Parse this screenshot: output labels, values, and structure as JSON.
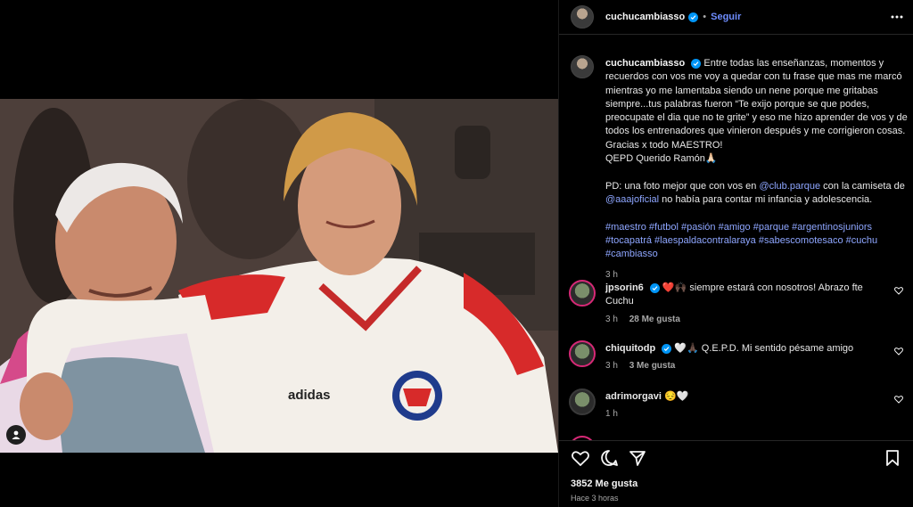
{
  "post": {
    "username": "cuchucambiasso",
    "follow_label": "Seguir",
    "dot": "•",
    "caption_pre": "Entre todas las enseñanzas, momentos y recuerdos con vos me voy a quedar con tu frase que mas me marcó mientras yo me lamentaba siendo un nene porque me gritabas siempre...tus palabras fueron “Te exijo porque se que podes, preocupate el dia que no te grite” y eso me hizo aprender de vos y de todos los entrenadores que vinieron después y me corrigieron cosas. Gracias x todo MAESTRO!",
    "caption_line2": "QEPD Querido Ramón🙏🏻",
    "caption_ps_1": "PD: una foto mejor que con vos en ",
    "mention_1": "@club.parque",
    "caption_ps_2": " con la camiseta de ",
    "mention_2": "@aaajoficial",
    "caption_ps_3": " no había para contar mi infancia y adolescencia.",
    "hashtags": "#maestro #futbol #pasión #amigo #parque #argentinosjuniors #tocapatrá #laespaldacontralaraya #sabescomotesaco #cuchu #cambiasso",
    "caption_time": "3 h",
    "likes": "3852 Me gusta",
    "posted_ago": "Hace 3 horas"
  },
  "comments": [
    {
      "user": "jpsorin6",
      "text": "❤️🙌🏿 siempre estará con nosotros! Abrazo fte Cuchu",
      "time": "3 h",
      "likes": "28 Me gusta",
      "verified": true
    },
    {
      "user": "chiquitodp",
      "text": "🤍🙏🏿 Q.E.P.D. Mi sentido pésame amigo",
      "time": "3 h",
      "likes": "3 Me gusta",
      "verified": true
    },
    {
      "user": "adrimorgavi",
      "text": "😔🤍",
      "time": "1 h",
      "likes": "",
      "verified": false
    }
  ],
  "photo": {
    "jersey_brand": "adidas"
  },
  "icons": {
    "more": "more-options-icon",
    "like": "heart-icon",
    "comment": "comment-icon",
    "share": "share-icon",
    "save": "bookmark-icon",
    "tag": "tagged-user-icon"
  },
  "colors": {
    "background": "#000000",
    "link": "#8ea6ff",
    "verified": "#0095f6",
    "muted": "#a8a8a8"
  }
}
